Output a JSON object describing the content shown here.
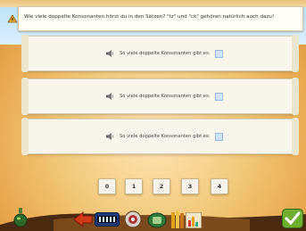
{
  "question": "Wie viele doppelte Konsonanten hörst du in den Sätzen? \"tz\" und \"ck\" gehören natürlich auch dazu!",
  "rows": [
    {
      "label": "So viele doppelte Konsonanten gibt es:",
      "value": ""
    },
    {
      "label": "So viele doppelte Konsonanten gibt es:",
      "value": ""
    },
    {
      "label": "So viele doppelte Konsonanten gibt es:",
      "value": ""
    }
  ],
  "numbers": [
    "0",
    "1",
    "2",
    "3",
    "4"
  ],
  "icons": {
    "question": "info-icon",
    "speaker": "speaker-icon",
    "bottom": [
      "potion-icon",
      "red-arrow-icon",
      "score-counter-icon",
      "dial-icon",
      "green-helper-icon",
      "books-icon",
      "chart-icon",
      "check-icon"
    ]
  },
  "colors": {
    "accent": "#6fae2f",
    "panel": "#f8f6ec",
    "background": "#f2c77a"
  }
}
